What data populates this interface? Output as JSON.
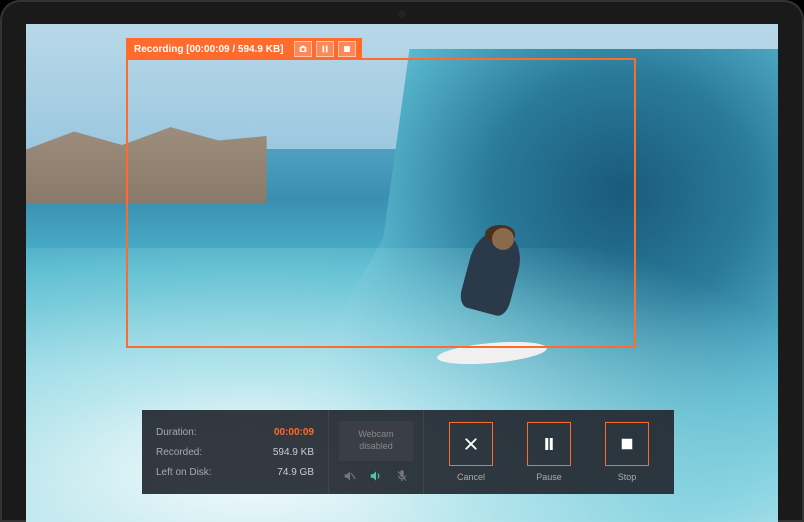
{
  "colors": {
    "accent": "#ff6b2c"
  },
  "recording_bar": {
    "label": "Recording [00:00:09 / 594.9 KB]",
    "buttons": {
      "screenshot": "camera-icon",
      "pause": "pause-icon",
      "stop": "stop-icon"
    }
  },
  "stats": {
    "duration_label": "Duration:",
    "duration_value": "00:00:09",
    "recorded_label": "Recorded:",
    "recorded_value": "594.9 KB",
    "left_label": "Left on Disk:",
    "left_value": "74.9 GB"
  },
  "webcam": {
    "text": "Webcam disabled",
    "system_audio_icon": "speaker-muted-icon",
    "output_audio_icon": "speaker-icon",
    "mic_icon": "mic-muted-icon"
  },
  "actions": {
    "cancel": {
      "label": "Cancel",
      "icon": "close-icon"
    },
    "pause": {
      "label": "Pause",
      "icon": "pause-icon"
    },
    "stop": {
      "label": "Stop",
      "icon": "stop-icon"
    }
  }
}
